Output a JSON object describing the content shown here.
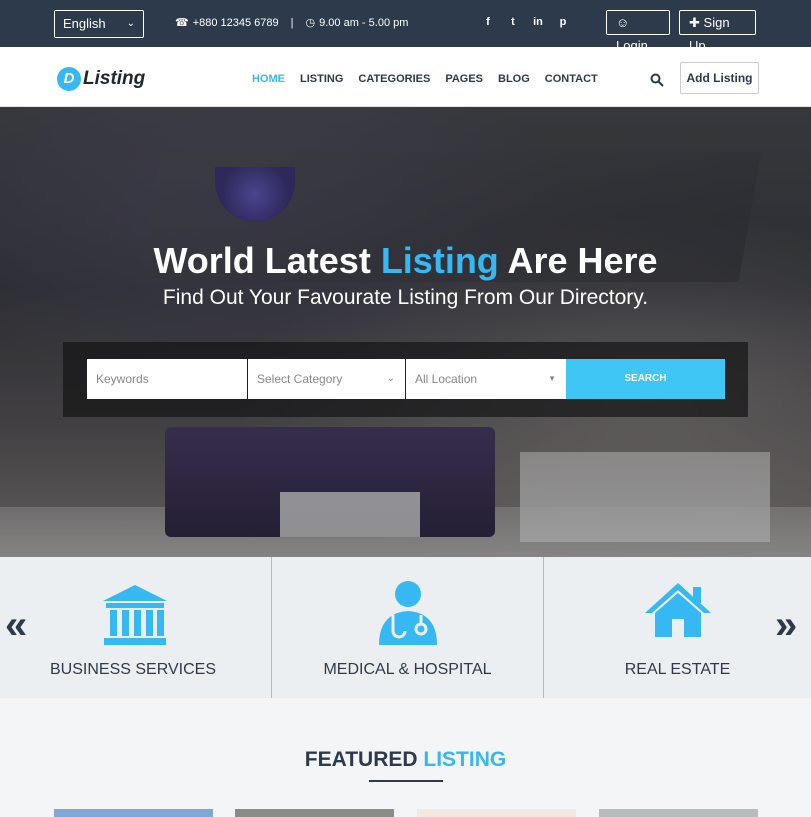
{
  "topbar": {
    "language": "English",
    "phone": "+880 12345 6789",
    "hours": "9.00 am - 5.00 pm",
    "separator": "|",
    "login_label": "Login",
    "signup_label": "Sign Up",
    "social_icons": [
      "facebook-icon",
      "twitter-icon",
      "linkedin-icon",
      "pinterest-icon"
    ]
  },
  "navbar": {
    "logo_letter": "D",
    "logo_text": "Listing",
    "menu": [
      "HOME",
      "LISTING",
      "CATEGORIES",
      "PAGES",
      "BLOG",
      "CONTACT"
    ],
    "active_menu": "HOME",
    "add_listing_label": "Add Listing"
  },
  "hero": {
    "title_pre": "World Latest ",
    "title_accent": "Listing",
    "title_post": " Are Here",
    "subtitle": "Find Out Your Favourate Listing From Our Directory.",
    "search": {
      "keywords_placeholder": "Keywords",
      "category_value": "Select Category",
      "location_value": "All Location",
      "button_label": "SEARCH"
    }
  },
  "categories": {
    "items": [
      {
        "label": "BUSINESS SERVICES",
        "icon": "bank-icon"
      },
      {
        "label": "MEDICAL & HOSPITAL",
        "icon": "doctor-icon"
      },
      {
        "label": "REAL ESTATE",
        "icon": "house-icon"
      }
    ],
    "prev_icon": "double-chevron-left-icon",
    "next_icon": "double-chevron-right-icon"
  },
  "featured": {
    "title_pre": "FEATURED ",
    "title_accent": "LISTING"
  },
  "colors": {
    "accent": "#36b8f3",
    "dark": "#2c3a4b",
    "search_button": "#3fc6f5"
  }
}
